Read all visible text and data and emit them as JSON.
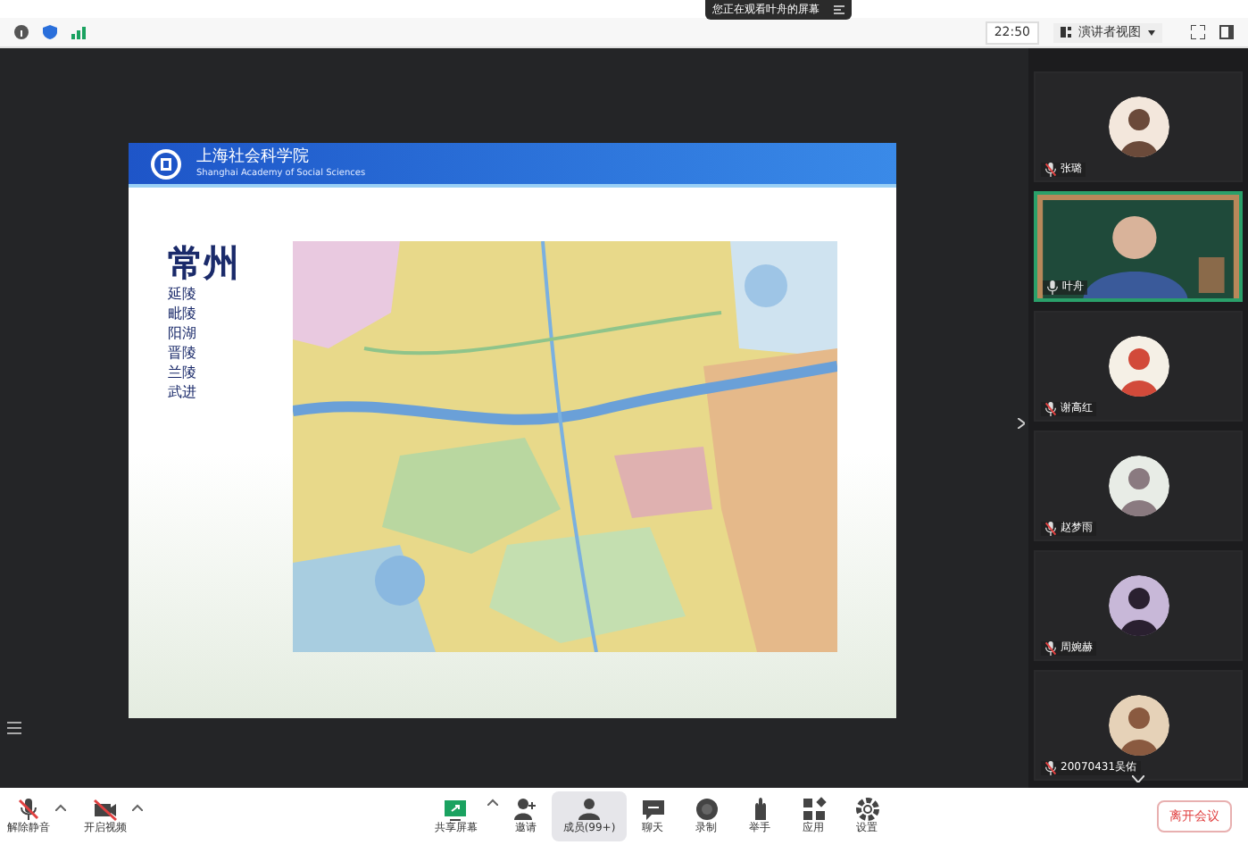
{
  "notice": "您正在观看叶舟的屏幕",
  "top_bar": {
    "time": "22:50",
    "view_button": "演讲者视图"
  },
  "slide": {
    "org_name": "上海社会科学院",
    "org_name_en": "Shanghai Academy of Social Sciences",
    "title": "常州",
    "names": [
      "延陵",
      "毗陵",
      "阳湖",
      "晋陵",
      "兰陵",
      "武进"
    ]
  },
  "participants": [
    {
      "name": "张璐",
      "kind": "avatar",
      "speaking": false
    },
    {
      "name": "叶舟",
      "kind": "video",
      "speaking": true
    },
    {
      "name": "谢高红",
      "kind": "avatar",
      "speaking": false
    },
    {
      "name": "赵梦雨",
      "kind": "avatar",
      "speaking": false
    },
    {
      "name": "周婉赫",
      "kind": "avatar",
      "speaking": false
    },
    {
      "name": "20070431吴佑",
      "kind": "avatar",
      "speaking": false
    }
  ],
  "toolbar_left": [
    {
      "label": "解除静音",
      "kind": "mic"
    },
    {
      "label": "开启视频",
      "kind": "camera"
    }
  ],
  "toolbar_center": [
    {
      "label": "共享屏幕",
      "kind": "share",
      "selected": false
    },
    {
      "label": "邀请",
      "kind": "invite",
      "selected": false
    },
    {
      "label": "成员(99+)",
      "kind": "members",
      "selected": true
    },
    {
      "label": "聊天",
      "kind": "chat",
      "selected": false
    },
    {
      "label": "录制",
      "kind": "record",
      "selected": false
    },
    {
      "label": "举手",
      "kind": "hand",
      "selected": false
    },
    {
      "label": "应用",
      "kind": "apps",
      "selected": false
    },
    {
      "label": "设置",
      "kind": "settings",
      "selected": false
    }
  ],
  "leave_button": "离开会议"
}
